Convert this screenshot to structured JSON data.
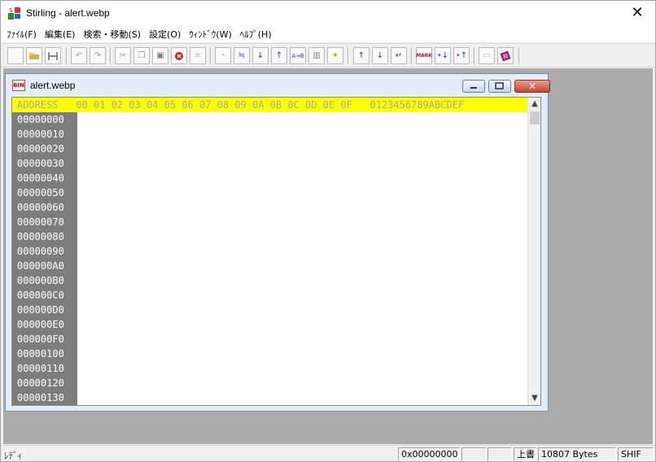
{
  "app": {
    "title": "Stirling - alert.webp",
    "close_glyph": "✕"
  },
  "menu": [
    "ﾌｧｲﾙ(F)",
    "編集(E)",
    "検索・移動(S)",
    "設定(O)",
    "ｳｨﾝﾄﾞｳ(W)",
    "ﾍﾙﾌﾟ(H)"
  ],
  "toolbar": {
    "icons": [
      "new-icon",
      "open-icon",
      "save-icon",
      "undo-icon",
      "redo-icon",
      "cut-icon",
      "copy-icon",
      "paste-icon",
      "delete-icon",
      "list-icon",
      "dot-icon",
      "split-icon",
      "move-down-icon",
      "move-up-icon",
      "ab-icon",
      "book-icon",
      "sparkle-icon",
      "arrow-up-icon",
      "arrow-down-icon",
      "enter-icon",
      "mark-icon",
      "mark-down-icon",
      "mark-up-icon",
      "notes-icon",
      "bookmark-icon"
    ]
  },
  "child_window": {
    "title": "alert.webp",
    "icon_label": "BIN"
  },
  "hex": {
    "header": "ADDRESS   00 01 02 03 04 05 06 07 08 09 0A 0B 0C 0D 0E 0F   0123456789ABCDEF",
    "addresses": [
      "00000000",
      "00000010",
      "00000020",
      "00000030",
      "00000040",
      "00000050",
      "00000060",
      "00000070",
      "00000080",
      "00000090",
      "000000A0",
      "000000B0",
      "000000C0",
      "000000D0",
      "000000E0",
      "000000F0",
      "00000100",
      "00000110",
      "00000120",
      "00000130"
    ]
  },
  "status": {
    "text": "ﾚﾃﾞｨ",
    "offset": "0x00000000",
    "mode": "上書",
    "size": "10807 Bytes",
    "charset": "SHIF"
  }
}
